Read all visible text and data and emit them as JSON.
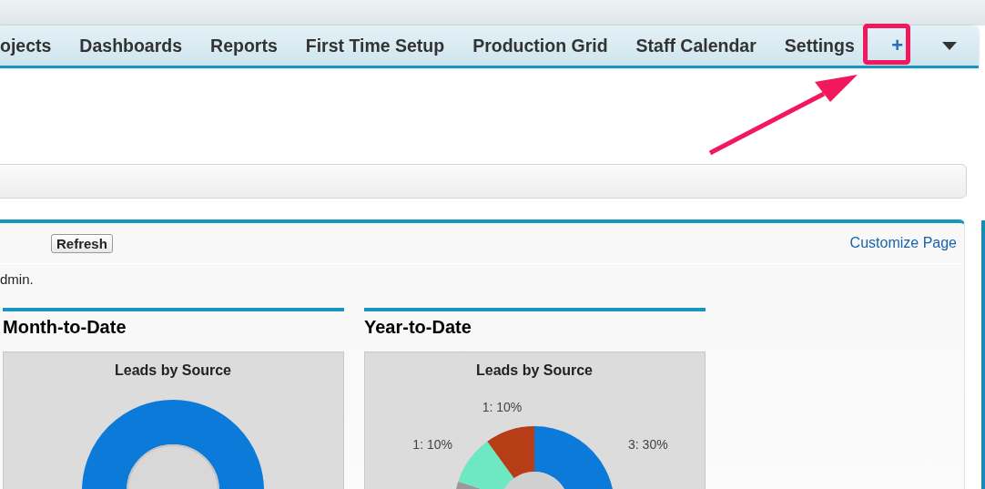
{
  "tabs": [
    {
      "label": "ojects",
      "selected": false
    },
    {
      "label": "Dashboards",
      "selected": false
    },
    {
      "label": "Reports",
      "selected": false
    },
    {
      "label": "First Time Setup",
      "selected": false
    },
    {
      "label": "Production Grid",
      "selected": false
    },
    {
      "label": "Staff Calendar",
      "selected": false
    },
    {
      "label": "Settings",
      "selected": false
    },
    {
      "label": "+",
      "selected": false,
      "kind": "add"
    }
  ],
  "dashboard": {
    "refresh_button": "Refresh",
    "customize_link": "Customize Page",
    "note": "dmin.",
    "components": [
      {
        "title": "Month-to-Date",
        "chart_title": "Leads by Source",
        "kind": "ring"
      },
      {
        "title": "Year-to-Date",
        "kind": "chart",
        "chart_data": {
          "type": "donut",
          "title": "Leads by Source",
          "values": [
            3,
            5,
            1,
            1
          ],
          "colors": [
            "#0b7ad8",
            "#9a9a9a",
            "#6de8c3",
            "#b73d16"
          ],
          "value_labels": [
            "3: 30%",
            null,
            "1: 10%",
            "1: 10%"
          ]
        }
      }
    ]
  }
}
